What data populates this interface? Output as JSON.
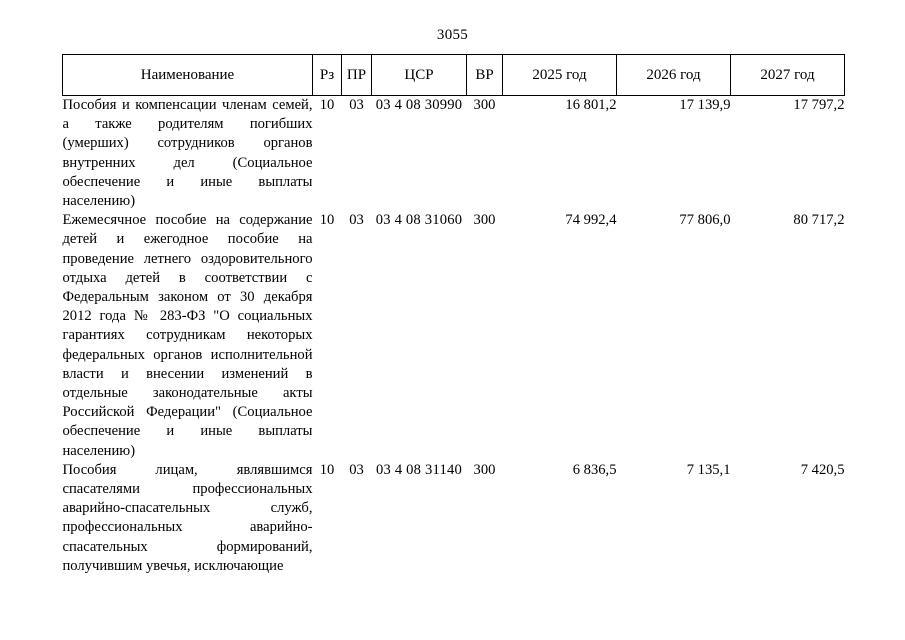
{
  "page": {
    "number": "3055"
  },
  "table": {
    "headers": {
      "name": "Наименование",
      "rz": "Рз",
      "pr": "ПР",
      "csr": "ЦСР",
      "vr": "ВР",
      "year1": "2025 год",
      "year2": "2026 год",
      "year3": "2027 год"
    },
    "rows": [
      {
        "name": "Пособия и компенсации членам семей, а также родителям погибших (умерших) сотрудников органов внутренних дел (Социальное обеспечение и иные выплаты",
        "name_last_line": "населению)",
        "rz": "10",
        "pr": "03",
        "csr": "03 4 08 30990",
        "vr": "300",
        "year1": "16 801,2",
        "year2": "17 139,9",
        "year3": "17 797,2"
      },
      {
        "name": "Ежемесячное пособие на содержание детей и ежегодное пособие на проведение летнего оздоровительного отдыха детей в соответствии с Федеральным законом от 30 декабря 2012 года № 283-ФЗ \"О социальных гарантиях сотрудникам некоторых федеральных органов исполнительной власти и внесении изменений в отдельные законодательные акты Российской Федерации\" (Социальное обеспечение и иные выплаты",
        "name_last_line": "населению)",
        "rz": "10",
        "pr": "03",
        "csr": "03 4 08 31060",
        "vr": "300",
        "year1": "74 992,4",
        "year2": "77 806,0",
        "year3": "80 717,2"
      },
      {
        "name": "Пособия лицам, являвшимся спасателями профессиональных аварийно-спасательных служб, профессиональных аварийно-спасательных формирований,",
        "name_last_line": "получившим увечья, исключающие",
        "rz": "10",
        "pr": "03",
        "csr": "03 4 08 31140",
        "vr": "300",
        "year1": "6 836,5",
        "year2": "7 135,1",
        "year3": "7 420,5"
      }
    ]
  }
}
